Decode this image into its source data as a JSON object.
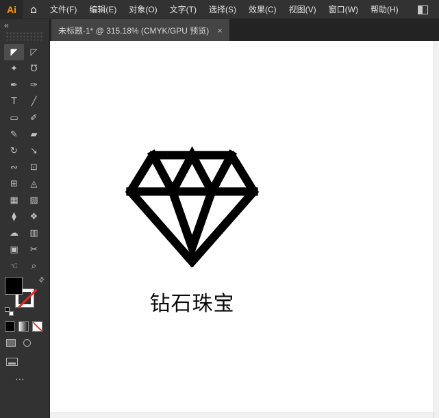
{
  "app": {
    "logo_text": "Ai",
    "accent_color": "#ff9a00"
  },
  "menubar": {
    "home_icon": "⌂",
    "items": [
      {
        "id": "file",
        "label": "文件(F)"
      },
      {
        "id": "edit",
        "label": "编辑(E)"
      },
      {
        "id": "object",
        "label": "对象(O)"
      },
      {
        "id": "type",
        "label": "文字(T)"
      },
      {
        "id": "select",
        "label": "选择(S)"
      },
      {
        "id": "effect",
        "label": "效果(C)"
      },
      {
        "id": "view",
        "label": "视图(V)"
      },
      {
        "id": "window",
        "label": "窗口(W)"
      },
      {
        "id": "help",
        "label": "帮助(H)"
      }
    ]
  },
  "tabbar": {
    "tab": {
      "label": "未标题-1* @ 315.18% (CMYK/GPU 预览)",
      "close_glyph": "×"
    }
  },
  "toolbar": {
    "collapse_glyph": "«",
    "swap_glyph": "⇄",
    "ellipsis_glyph": "⋯",
    "fill_color": "#000000",
    "stroke_style": "none",
    "tools": [
      {
        "name": "selection-tool",
        "glyph": "◤",
        "active": true
      },
      {
        "name": "direct-selection-tool",
        "glyph": "◸"
      },
      {
        "name": "magic-wand-tool",
        "glyph": "✦"
      },
      {
        "name": "lasso-tool",
        "glyph": "℧"
      },
      {
        "name": "pen-tool",
        "glyph": "✒"
      },
      {
        "name": "curvature-tool",
        "glyph": "✑"
      },
      {
        "name": "type-tool",
        "glyph": "T"
      },
      {
        "name": "line-segment-tool",
        "glyph": "╱"
      },
      {
        "name": "rectangle-tool",
        "glyph": "▭"
      },
      {
        "name": "paintbrush-tool",
        "glyph": "✐"
      },
      {
        "name": "shaper-tool",
        "glyph": "✎"
      },
      {
        "name": "eraser-tool",
        "glyph": "▰"
      },
      {
        "name": "rotate-tool",
        "glyph": "↻"
      },
      {
        "name": "scale-tool",
        "glyph": "↘"
      },
      {
        "name": "width-tool",
        "glyph": "∾"
      },
      {
        "name": "free-transform-tool",
        "glyph": "⊡"
      },
      {
        "name": "shape-builder-tool",
        "glyph": "⊞"
      },
      {
        "name": "perspective-grid-tool",
        "glyph": "◬"
      },
      {
        "name": "mesh-tool",
        "glyph": "▦"
      },
      {
        "name": "gradient-tool",
        "glyph": "▨"
      },
      {
        "name": "eyedropper-tool",
        "glyph": "⧫"
      },
      {
        "name": "blend-tool",
        "glyph": "❖"
      },
      {
        "name": "symbol-sprayer-tool",
        "glyph": "☁"
      },
      {
        "name": "column-graph-tool",
        "glyph": "▥"
      },
      {
        "name": "artboard-tool",
        "glyph": "▣"
      },
      {
        "name": "slice-tool",
        "glyph": "✂"
      },
      {
        "name": "hand-tool",
        "glyph": "☜"
      },
      {
        "name": "zoom-tool",
        "glyph": "⌕"
      }
    ]
  },
  "canvas": {
    "logo_text": "钻石珠宝",
    "artwork_color": "#000000",
    "background_color": "#ffffff"
  }
}
